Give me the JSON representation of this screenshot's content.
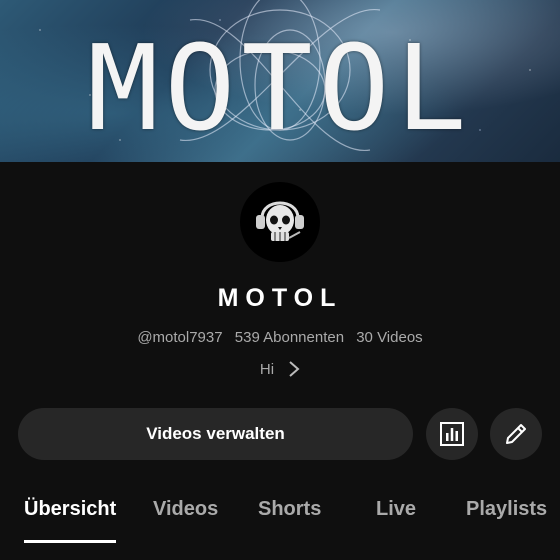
{
  "banner": {
    "title": "MOTOL"
  },
  "channel": {
    "name": "MOTOL",
    "handle": "@motol7937",
    "subscribers": "539 Abonnenten",
    "videos": "30 Videos",
    "description": "Hi"
  },
  "actions": {
    "manage_videos_label": "Videos verwalten",
    "analytics_icon": "bar-chart-icon",
    "edit_icon": "pencil-icon"
  },
  "tabs": [
    {
      "label": "Übersicht",
      "active": true
    },
    {
      "label": "Videos",
      "active": false
    },
    {
      "label": "Shorts",
      "active": false
    },
    {
      "label": "Live",
      "active": false
    },
    {
      "label": "Playlists",
      "active": false
    }
  ],
  "colors": {
    "background": "#0f0f0f",
    "button_bg": "#272727",
    "secondary_text": "#aaaaaa"
  }
}
